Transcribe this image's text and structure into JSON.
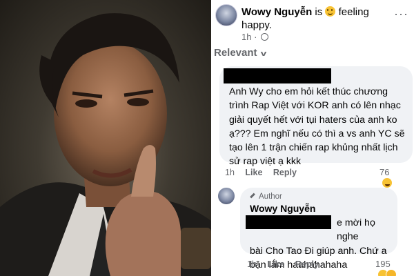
{
  "post": {
    "author": "Wowy Nguyễn",
    "status_prefix": "is",
    "status_text": "feeling happy.",
    "time": "1h",
    "privacy_icon": "globe-icon",
    "more_label": "···"
  },
  "comments_filter": {
    "label": "Relevant"
  },
  "comment_1": {
    "text": "Anh Wy cho em hỏi kết thúc chương trình Rap Việt với KOR anh có lên nhạc giải quyết hết với tụi haters của anh ko ạ??? Em nghĩ nếu có thì a vs anh YC sẽ tạo lên 1 trận chiến rap khủng nhất lịch sử rap việt ạ kkk",
    "time": "1h",
    "like": "Like",
    "reply": "Reply",
    "reactions": "76"
  },
  "comment_2": {
    "badge": "Author",
    "author": "Wowy Nguyễn",
    "text_line1": "e mời họ nghe",
    "text_rest": "bài Cho Tao Đi giúp anh. Chứ a bận lắm haahahahaha",
    "time": "1h",
    "like": "Like",
    "reply": "Reply",
    "reactions": "195"
  },
  "colors": {
    "bubble": "#f0f2f5",
    "meta": "#65676b",
    "text": "#050505",
    "emoji": "#f7c234"
  }
}
